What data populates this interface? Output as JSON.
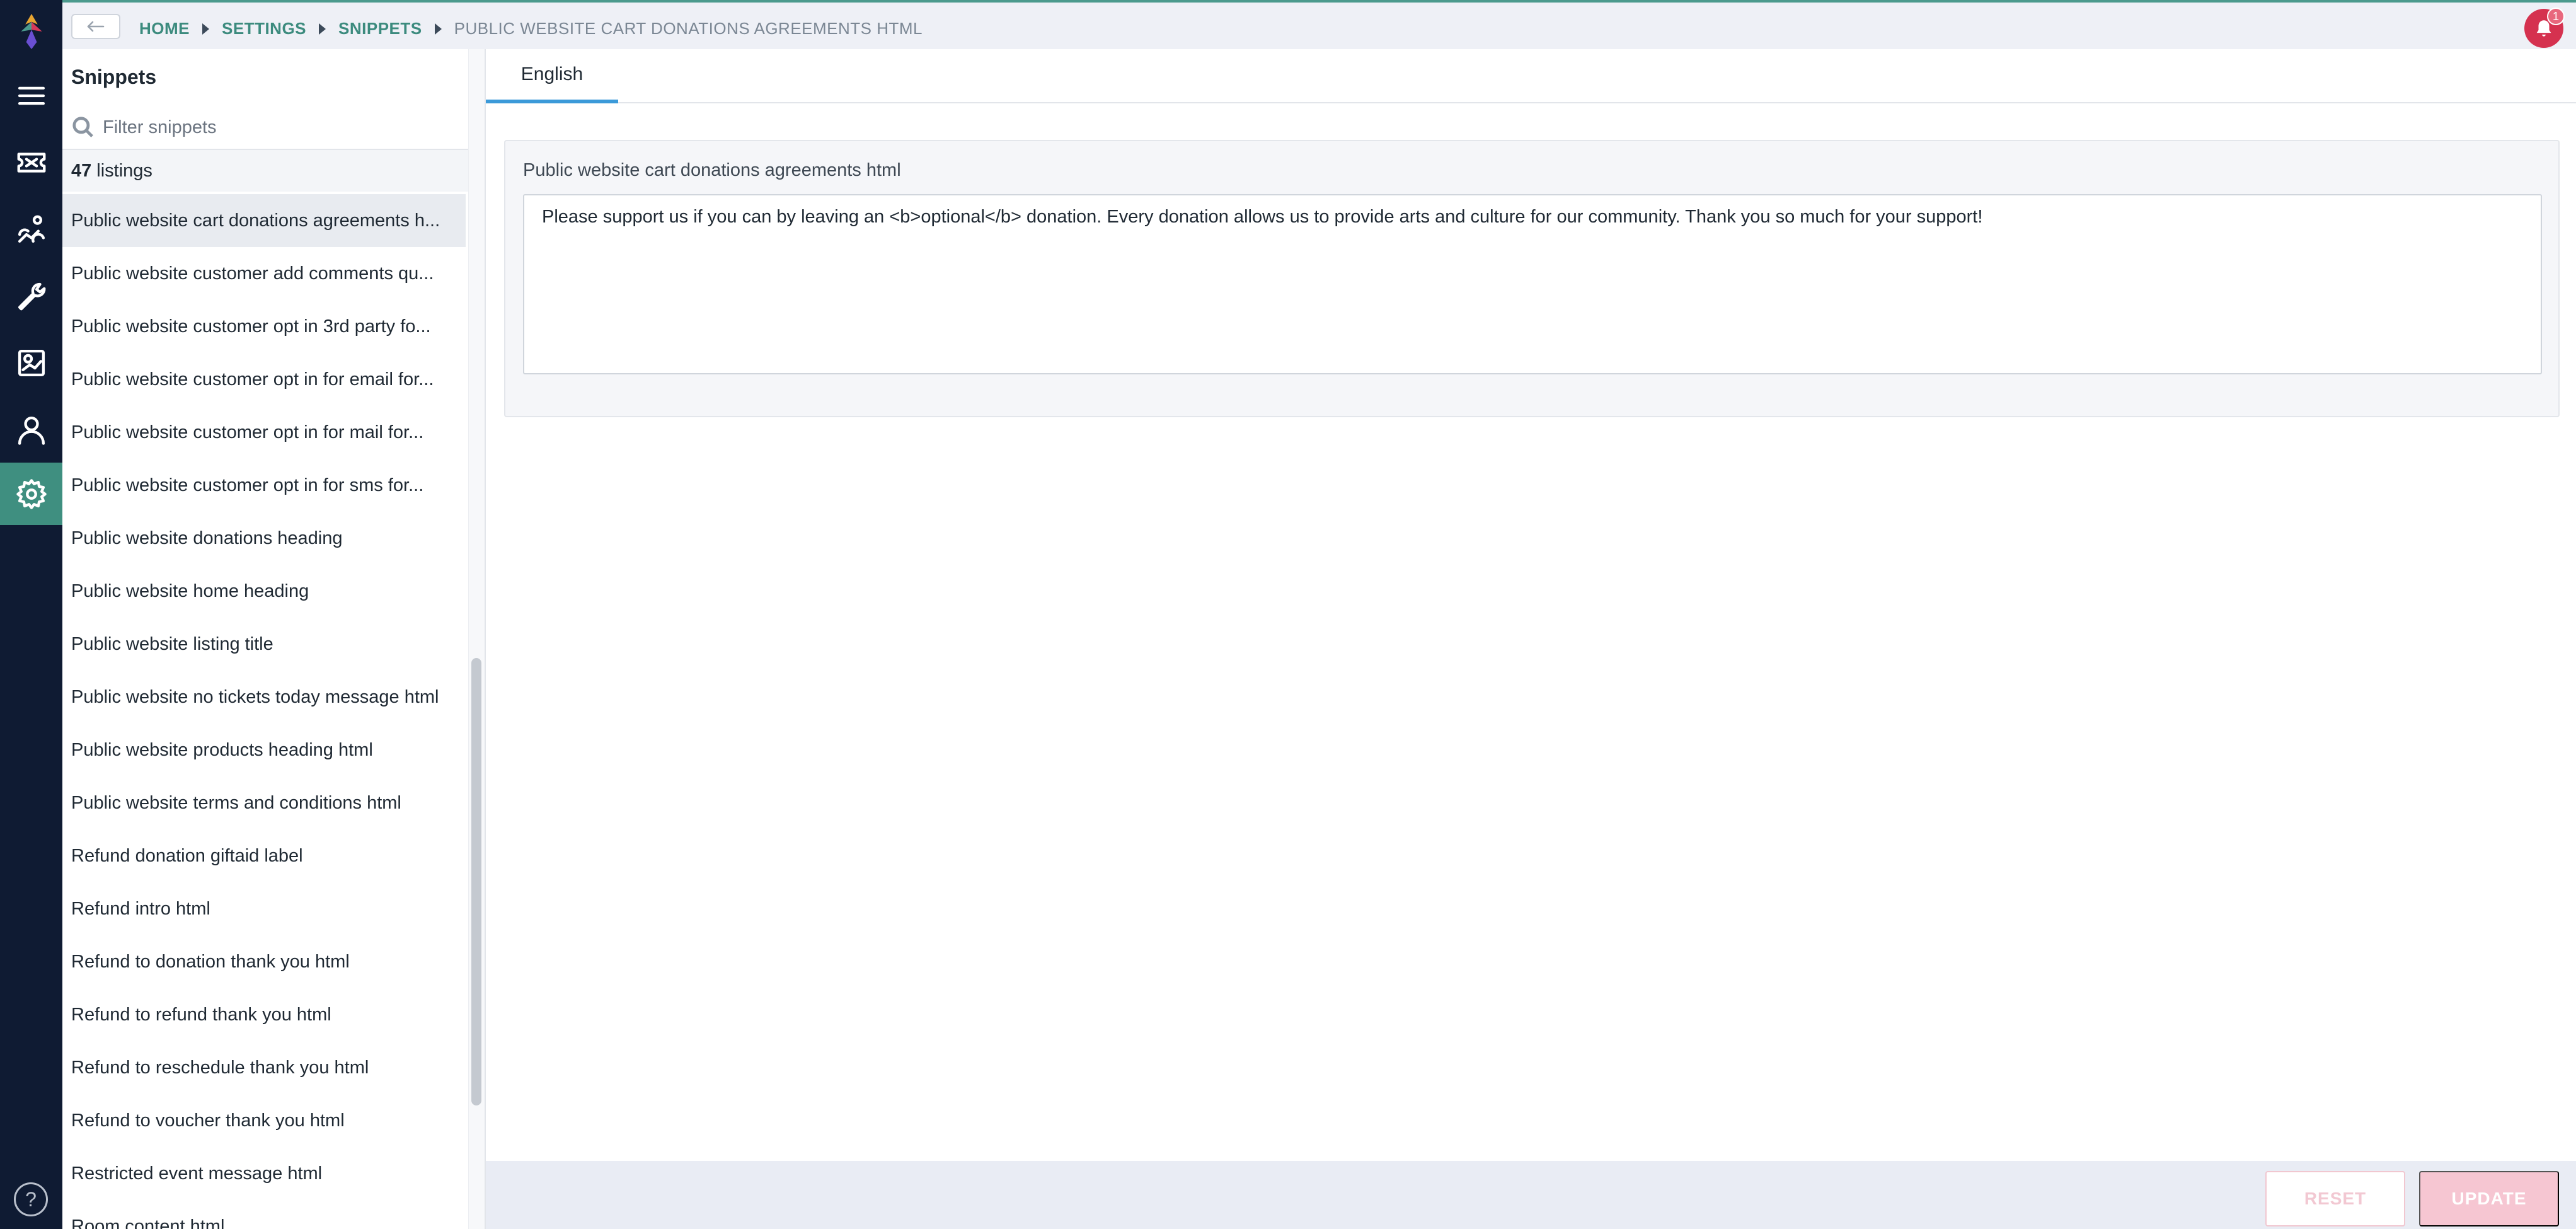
{
  "breadcrumb": {
    "items": [
      "HOME",
      "SETTINGS",
      "SNIPPETS"
    ],
    "current": "PUBLIC WEBSITE CART DONATIONS AGREEMENTS HTML"
  },
  "notifications": {
    "count": "1"
  },
  "sidebar": {
    "title": "Snippets",
    "filter_placeholder": "Filter snippets",
    "count": "47",
    "count_label": "listings",
    "items": [
      "Public website cart donations agreements h...",
      "Public website customer add comments qu...",
      "Public website customer opt in 3rd party fo...",
      "Public website customer opt in for email for...",
      "Public website customer opt in for mail for...",
      "Public website customer opt in for sms for...",
      "Public website donations heading",
      "Public website home heading",
      "Public website listing title",
      "Public website no tickets today message html",
      "Public website products heading html",
      "Public website terms and conditions html",
      "Refund donation giftaid label",
      "Refund intro html",
      "Refund to donation thank you html",
      "Refund to refund thank you html",
      "Refund to reschedule thank you html",
      "Refund to voucher thank you html",
      "Restricted event message html",
      "Room content html"
    ]
  },
  "tabs": [
    {
      "label": "English"
    }
  ],
  "editor": {
    "label": "Public website cart donations agreements html",
    "value": "Please support us if you can by leaving an <b>optional</b> donation. Every donation allows us to provide arts and culture for our community. Thank you so much for your support!"
  },
  "footer": {
    "reset_label": "RESET",
    "update_label": "UPDATE"
  },
  "help": {
    "label": "?"
  },
  "icons": {
    "rail": [
      "logo-icon",
      "menu-icon",
      "ticket-icon",
      "tools-icon",
      "wrench-icon",
      "reports-icon",
      "user-icon",
      "gear-icon"
    ],
    "accent": "#3f8f80",
    "rail_bg": "#0f1b33"
  }
}
